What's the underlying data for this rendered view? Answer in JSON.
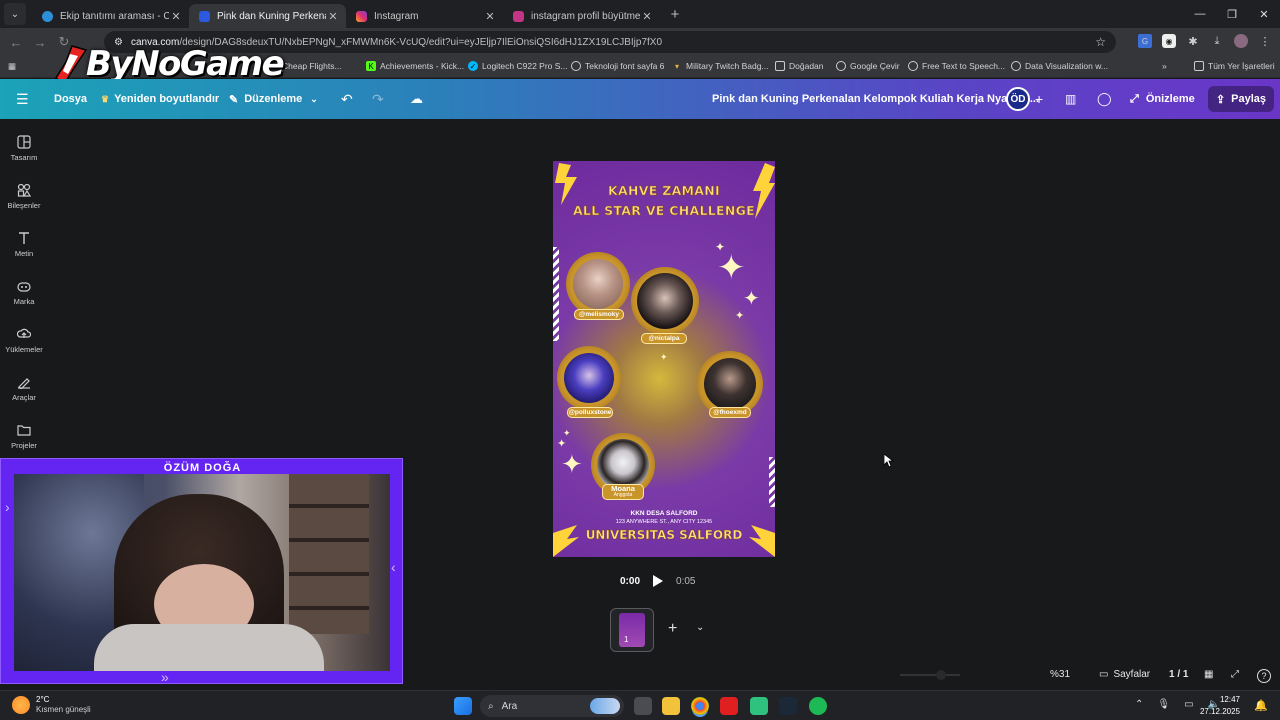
{
  "browser": {
    "tabs": [
      {
        "title": "Ekip tanıtımı araması - Canva",
        "active": false,
        "color": "#2d8fd8"
      },
      {
        "title": "Pink dan Kuning Perkenalan Kel",
        "active": true,
        "color": "#2b5ae0"
      },
      {
        "title": "Instagram",
        "active": false,
        "color": "#e1306c"
      },
      {
        "title": "instagram profil büyütme insta",
        "active": false,
        "color": "#c13584"
      }
    ],
    "url_host": "canva.com",
    "url_path": "/design/DAG8sdeuxTU/NxbEPNgN_xFMWMn6K-VcUQ/edit?ui=eyJEljp7IlEiOnsiQSI6dHJ1ZX19LCJBIjp7fX0",
    "bookmarks": [
      {
        "label": "Cheap Flights...",
        "icon": "flight-icon"
      },
      {
        "label": "Achievements - Kick...",
        "icon": "kick-icon"
      },
      {
        "label": "Logitech C922 Pro S...",
        "icon": "logitech-icon"
      },
      {
        "label": "Teknoloji font sayfa 6",
        "icon": "globe-icon"
      },
      {
        "label": "Military Twitch Badg...",
        "icon": "badge-icon"
      },
      {
        "label": "Doğadan",
        "icon": "folder-icon"
      },
      {
        "label": "Google Çevir",
        "icon": "globe-icon"
      },
      {
        "label": "Free Text to Speech...",
        "icon": "globe-icon"
      },
      {
        "label": "Data Visualization w...",
        "icon": "globe-icon"
      },
      {
        "label": "»",
        "icon": "more-icon"
      },
      {
        "label": "Tüm Yer İşaretleri",
        "icon": "folder-icon"
      }
    ]
  },
  "canva": {
    "menu": {
      "file": "Dosya",
      "resize": "Yeniden boyutlandır",
      "edit": "Düzenleme"
    },
    "doc_title": "Pink dan Kuning Perkenalan Kelompok Kuliah Kerja Nyata In...",
    "avatar": "ÖD",
    "preview": "Önizleme",
    "share": "Paylaş",
    "sidebar": [
      {
        "label": "Tasarım",
        "icon": "template-icon"
      },
      {
        "label": "Bileşenler",
        "icon": "elements-icon"
      },
      {
        "label": "Metin",
        "icon": "text-icon"
      },
      {
        "label": "Marka",
        "icon": "brand-icon"
      },
      {
        "label": "Yüklemeler",
        "icon": "upload-icon"
      },
      {
        "label": "Araçlar",
        "icon": "tools-icon"
      },
      {
        "label": "Projeler",
        "icon": "folder-icon"
      }
    ],
    "design": {
      "title_line1": "KAHVE ZAMANI",
      "title_line2": "ALL STAR VE CHALLENGE",
      "profiles": [
        {
          "handle": "@melismoky"
        },
        {
          "handle": "@nictalpa"
        },
        {
          "handle": "@polluxstone"
        },
        {
          "handle": "@fhoexmd"
        },
        {
          "handle": "Moana",
          "subtitle": "Anggota"
        }
      ],
      "footer_line1": "KKN DESA SALFORD",
      "footer_line2": "123 ANYWHERE ST., ANY CITY 12345",
      "footer_line3": "UNIVERSITAS SALFORD",
      "colors": {
        "bg": "#6d2a9d",
        "accent": "#ffd43a"
      }
    },
    "playback": {
      "current": "0:00",
      "total": "0:05"
    },
    "page_thumb_number": "1",
    "zoom": "%31",
    "pages_label": "Sayfalar",
    "page_count": "1 / 1"
  },
  "stream": {
    "name": "ÖZÜM DOĞA",
    "watermark": "ByNoGame"
  },
  "taskbar": {
    "temp": "2°C",
    "weather": "Kısmen güneşli",
    "search": "Ara",
    "time": "12:47",
    "date": "27.12.2025"
  }
}
